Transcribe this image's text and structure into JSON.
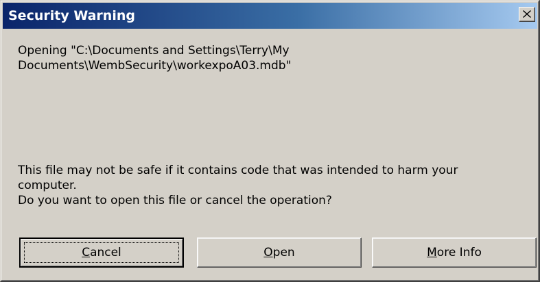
{
  "window": {
    "title": "Security Warning",
    "close_glyph": "×"
  },
  "message": {
    "path_text": "Opening \"C:\\Documents and Settings\\Terry\\My\nDocuments\\WembSecurity\\workexpoA03.mdb\"",
    "warning_text": "This file may not be safe if it contains code that was intended to harm your\ncomputer.\nDo you want to open this file or cancel the operation?"
  },
  "buttons": {
    "cancel": {
      "accel": "C",
      "rest": "ancel"
    },
    "open": {
      "accel": "O",
      "rest": "pen"
    },
    "more_info": {
      "accel": "M",
      "rest": "ore Info"
    }
  },
  "colors": {
    "title_gradient_start": "#0a246a",
    "title_gradient_end": "#a6caf0",
    "face": "#d4d0c8"
  }
}
